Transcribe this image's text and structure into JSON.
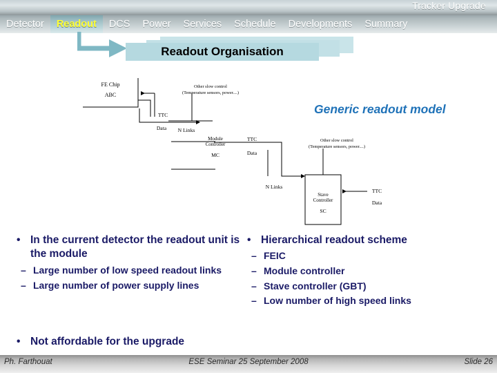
{
  "deck": {
    "title": "Tracker Upgrade"
  },
  "nav": {
    "items": [
      {
        "label": "Detector",
        "active": false
      },
      {
        "label": "Readout",
        "active": true
      },
      {
        "label": "DCS",
        "active": false
      },
      {
        "label": "Power",
        "active": false
      },
      {
        "label": "Services",
        "active": false
      },
      {
        "label": "Schedule",
        "active": false
      },
      {
        "label": "Developments",
        "active": false
      },
      {
        "label": "Summary",
        "active": false
      }
    ],
    "active_color": "#ffff33",
    "inactive_color": "#ffffff",
    "active_tab_bg": "#a8cdd3"
  },
  "slide": {
    "title": "Readout Organisation",
    "title_box_color": "#b5d9e0",
    "arrow_color": "#7fb8c4"
  },
  "caption": {
    "generic_model": "Generic readout model",
    "color": "#1f72b8"
  },
  "diagram": {
    "labels": {
      "fe_chip": "FE Chip",
      "fe_chip_sub": "ABC",
      "slow_control_1_line1": "Other slow control",
      "slow_control_1_line2": "(Temperature sensors, power....)",
      "slow_control_2_line1": "Other slow control",
      "slow_control_2_line2": "(Temperature sensors, power....)",
      "ttc_1": "TTC",
      "data_1": "Data",
      "n_links_1": "N Links",
      "module_controller_line1": "Module",
      "module_controller_line2": "Controller",
      "module_controller_abbr": "MC",
      "ttc_2": "TTC",
      "data_2": "Data",
      "n_links_2": "N Links",
      "stave_controller_line1": "Stave",
      "stave_controller_line2": "Controller",
      "stave_controller_abbr": "SC",
      "ttc_3": "TTC",
      "data_3": "Data"
    },
    "line_color": "#000000"
  },
  "content": {
    "left": {
      "bullet": "In the current detector the readout unit is the module",
      "sub": [
        "Large number of low speed readout links",
        "Large number of power supply lines"
      ]
    },
    "right": {
      "bullet": "Hierarchical readout scheme",
      "sub": [
        "FEIC",
        "Module controller",
        "Stave controller (GBT)",
        "Low number of high speed links"
      ]
    },
    "bottom_bullet": "Not affordable for the upgrade",
    "bullet_marker": "•",
    "sub_marker": "–",
    "text_color": "#1a1a66"
  },
  "footer": {
    "author": "Ph. Farthouat",
    "event": "ESE Seminar 25 September 2008",
    "slide_number": "Slide 26"
  }
}
